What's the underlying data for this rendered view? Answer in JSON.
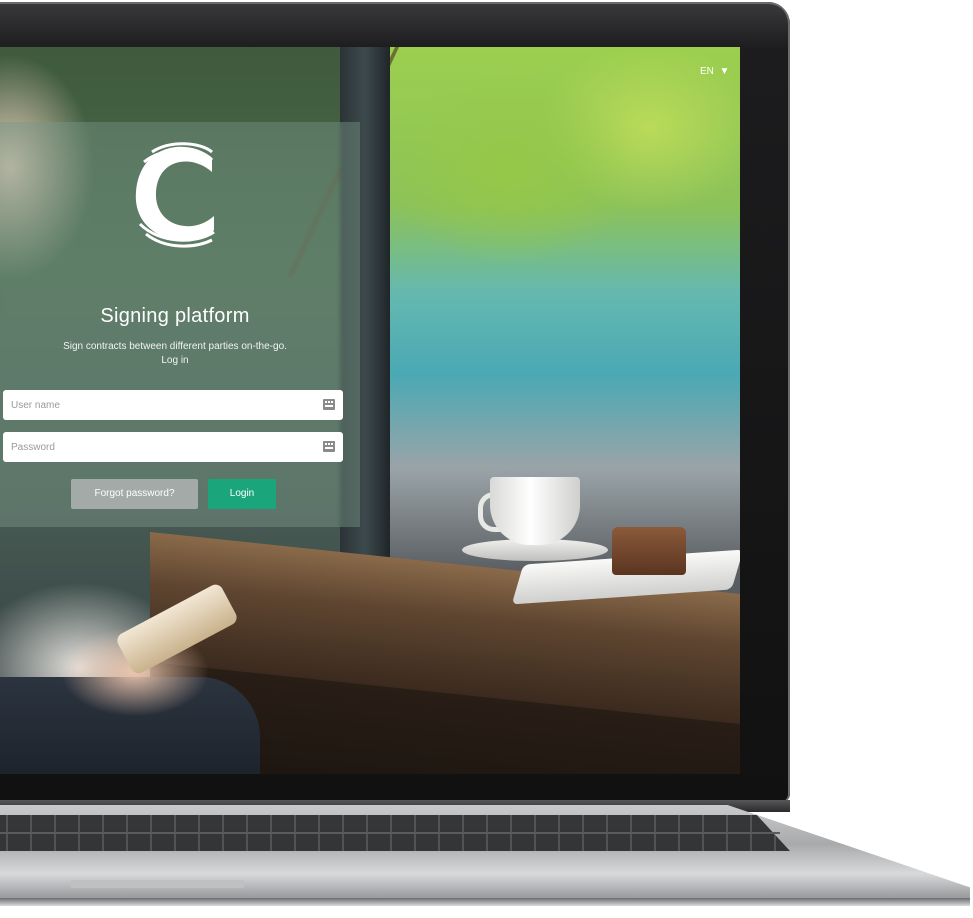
{
  "app": {
    "title": "Signing platform",
    "subtitle": "Sign contracts between different parties on-the-go.",
    "subtitle_action": "Log in"
  },
  "language": {
    "selected": "EN",
    "icon": "caret-down-icon"
  },
  "form": {
    "username_placeholder": "User name",
    "username_value": "",
    "password_placeholder": "Password",
    "password_value": "",
    "field_icon": "keyboard-icon",
    "forgot_label": "Forgot password?",
    "login_label": "Login"
  },
  "colors": {
    "login_button": "#1aa67a",
    "forgot_button": "#a3aaa7"
  }
}
